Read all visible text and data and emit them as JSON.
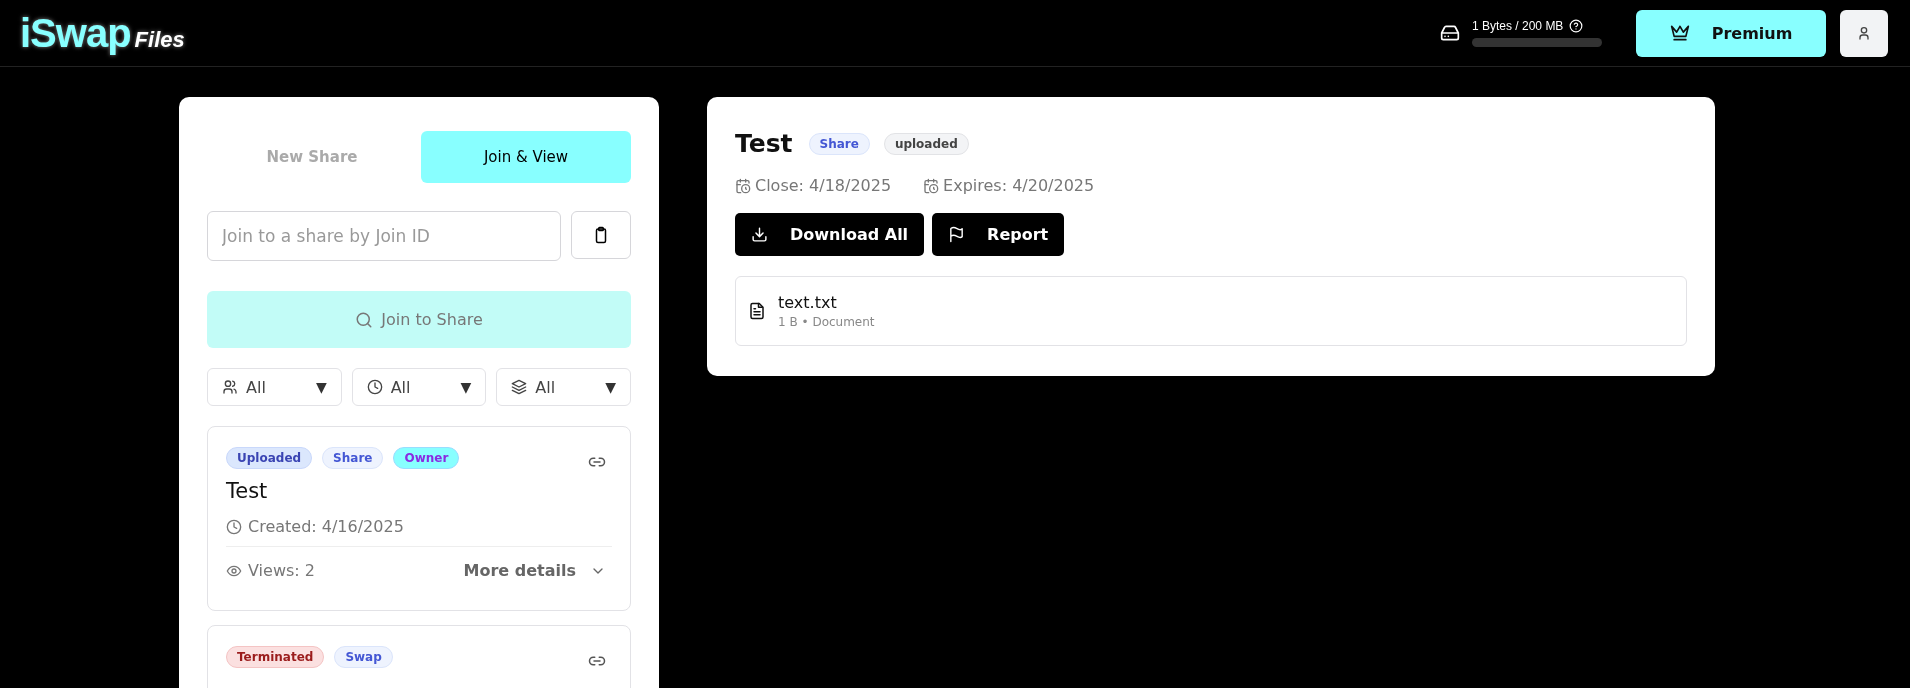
{
  "header": {
    "logo": {
      "brand": "iSwap",
      "product": "Files"
    },
    "storage": {
      "text": "1 Bytes / 200 MB"
    },
    "premium_button": "Premium"
  },
  "sidebar": {
    "tabs": [
      {
        "label": "New Share",
        "selected": false
      },
      {
        "label": "Join & View",
        "selected": true
      }
    ],
    "join_field": {
      "placeholder": "Join to a share by Join ID"
    },
    "join_button": {
      "label": "Join to Share",
      "disabled": true
    },
    "filters": [
      {
        "kind": "people",
        "value": "All",
        "arrow": "▼"
      },
      {
        "kind": "clock",
        "value": "All",
        "arrow": "▼"
      },
      {
        "kind": "layers",
        "value": "All",
        "arrow": "▼"
      }
    ],
    "shares": [
      {
        "tags": [
          {
            "label": "Uploaded",
            "kind": "info"
          },
          {
            "label": "Share",
            "kind": "type"
          },
          {
            "label": "Owner",
            "kind": "role"
          }
        ],
        "title": "Test",
        "created": "Created: 4/16/2025",
        "views": "Views: 2",
        "more": "More details"
      },
      {
        "tags": [
          {
            "label": "Terminated",
            "kind": "danger"
          },
          {
            "label": "Swap",
            "kind": "type"
          }
        ]
      }
    ]
  },
  "detail": {
    "title": "Test",
    "badges": [
      {
        "label": "Share",
        "kind": "type"
      },
      {
        "label": "uploaded",
        "kind": "neutral"
      }
    ],
    "dates": [
      "Close: 4/18/2025",
      "Expires: 4/20/2025"
    ],
    "actions": [
      {
        "kind": "download",
        "label": "Download All"
      },
      {
        "kind": "report",
        "label": "Report"
      }
    ],
    "files": [
      {
        "name": "text.txt",
        "meta": "1 B • Document"
      }
    ]
  }
}
